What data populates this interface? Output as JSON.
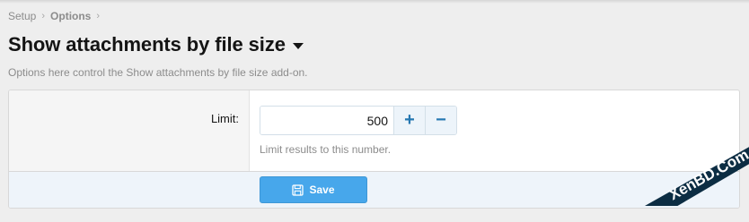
{
  "breadcrumb": {
    "items": [
      "Setup",
      "Options"
    ]
  },
  "page": {
    "title": "Show attachments by file size",
    "description": "Options here control the Show attachments by file size add-on."
  },
  "option": {
    "label": "Limit:",
    "value": "500",
    "increment_symbol": "+",
    "decrement_symbol": "−",
    "hint": "Limit results to this number."
  },
  "actions": {
    "save_label": "Save",
    "save_icon": "floppy-disk-icon"
  },
  "watermark": {
    "text": "XenBD.Com"
  },
  "colors": {
    "accent": "#47a7eb",
    "stepper_button_bg": "#edf4fa",
    "stepper_button_fg": "#2577b1",
    "footer_bg": "#eef4fa",
    "watermark_bg": "#0c2d43",
    "watermark_fg": "#ffffff"
  }
}
